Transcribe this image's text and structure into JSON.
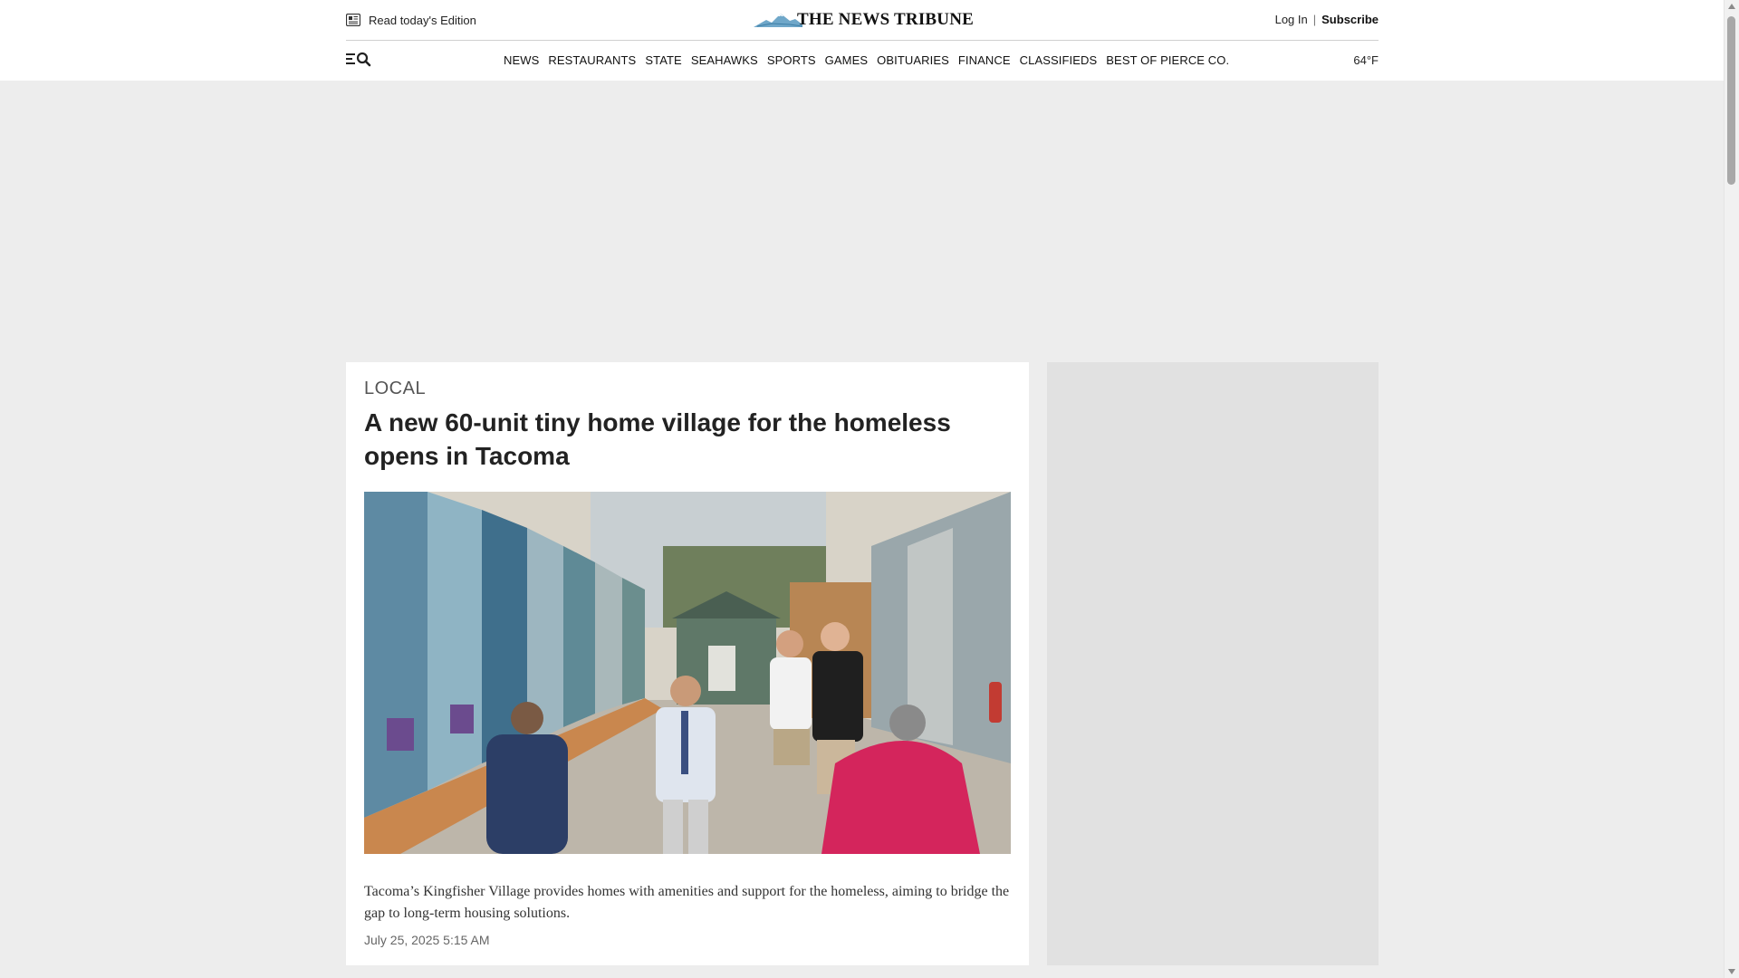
{
  "header": {
    "edition_label": "Read today's Edition",
    "logo_text": "THE NEWS TRIBUNE",
    "login_label": "Log In",
    "separator": "|",
    "subscribe_label": "Subscribe",
    "weather": "64°F"
  },
  "nav": {
    "items": [
      {
        "label": "NEWS"
      },
      {
        "label": "RESTAURANTS"
      },
      {
        "label": "STATE"
      },
      {
        "label": "SEAHAWKS"
      },
      {
        "label": "SPORTS"
      },
      {
        "label": "GAMES"
      },
      {
        "label": "OBITUARIES"
      },
      {
        "label": "FINANCE"
      },
      {
        "label": "CLASSIFIEDS"
      },
      {
        "label": "BEST OF PIERCE CO."
      }
    ]
  },
  "article": {
    "section": "LOCAL",
    "headline": "A new 60-unit tiny home village for the homeless opens in Tacoma",
    "summary": "Tacoma’s Kingfisher Village provides homes with amenities and support for the homeless, aiming to bridge the gap to long-term housing solutions.",
    "timestamp": "July 25, 2025 5:15 AM"
  },
  "icons": {
    "edition": "newspaper-icon",
    "menu": "menu-icon",
    "search": "search-icon",
    "logo": "mountain-logo-icon"
  },
  "colors": {
    "header_bg": "#ffffff",
    "page_bg": "#ededed",
    "sidebar_ad_bg": "#e1e1e1",
    "section_label": "#555555"
  }
}
